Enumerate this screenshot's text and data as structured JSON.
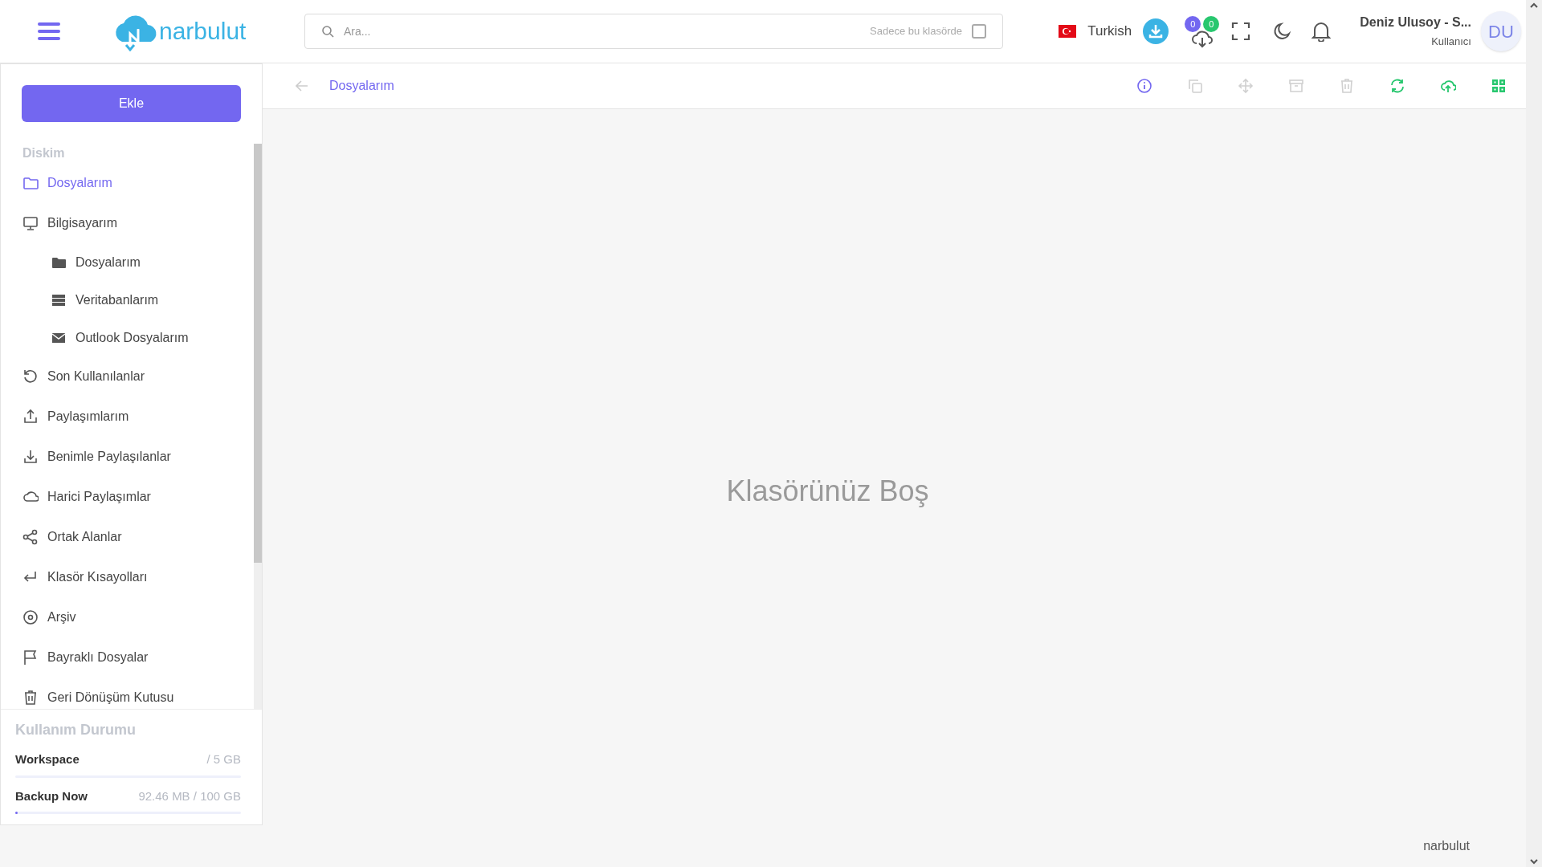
{
  "header": {
    "logo_text": "narbulut",
    "search": {
      "placeholder": "Ara..."
    },
    "folder_only": {
      "label": "Sadece bu klasörde",
      "checked": false
    },
    "language": "Turkish",
    "badges": [
      {
        "text": "0",
        "color": "#7367f0"
      },
      {
        "text": "0",
        "color": "#28c76f"
      }
    ],
    "user": {
      "name": "Deniz Ulusoy - S...",
      "role": "Kullanıcı",
      "initials": "DU"
    }
  },
  "sidebar": {
    "add_button": "Ekle",
    "section": "Diskim",
    "items": [
      {
        "kind": "folder",
        "label": "Dosyalarım",
        "selected": true
      },
      {
        "kind": "monitor",
        "label": "Bilgisayarım",
        "selected": false,
        "children": [
          {
            "kind": "folder-solid",
            "label": "Dosyalarım",
            "selected": false
          },
          {
            "kind": "database",
            "label": "Veritabanlarım",
            "selected": false
          },
          {
            "kind": "mail",
            "label": "Outlook Dosyalarım",
            "selected": false
          }
        ]
      },
      {
        "kind": "history",
        "label": "Son Kullanılanlar",
        "selected": false
      },
      {
        "kind": "upload",
        "label": "Paylaşımlarım",
        "selected": false
      },
      {
        "kind": "download",
        "label": "Benimle Paylaşılanlar",
        "selected": false
      },
      {
        "kind": "cloud",
        "label": "Harici Paylaşımlar",
        "selected": false
      },
      {
        "kind": "share",
        "label": "Ortak Alanlar",
        "selected": false
      },
      {
        "kind": "return",
        "label": "Klasör Kısayolları",
        "selected": false
      },
      {
        "kind": "disc",
        "label": "Arşiv",
        "selected": false
      },
      {
        "kind": "flag",
        "label": "Bayraklı Dosyalar",
        "selected": false
      },
      {
        "kind": "trash",
        "label": "Geri Dönüşüm Kutusu",
        "selected": false
      }
    ],
    "usage": {
      "title": "Kullanım Durumu",
      "rows": [
        {
          "name": "Workspace",
          "value": "/ 5 GB",
          "level": 0
        },
        {
          "name": "Backup Now",
          "value": "92.46 MB / 100 GB",
          "level": 0.01
        }
      ]
    }
  },
  "toolbar": {
    "breadcrumb": "Dosyalarım",
    "actions": [
      {
        "kind": "info",
        "disabled": false,
        "color": "#7367f0"
      },
      {
        "kind": "copy",
        "disabled": true
      },
      {
        "kind": "move",
        "disabled": true
      },
      {
        "kind": "archive",
        "disabled": true
      },
      {
        "kind": "trash",
        "disabled": true
      },
      {
        "kind": "refresh",
        "disabled": false,
        "color": "#28c76f"
      },
      {
        "kind": "cloud-upload",
        "disabled": false,
        "color": "#28c76f"
      },
      {
        "kind": "grid",
        "disabled": false,
        "color": "#28c76f"
      }
    ]
  },
  "empty_message": "Klasörünüz Boş",
  "footer": "narbulut"
}
